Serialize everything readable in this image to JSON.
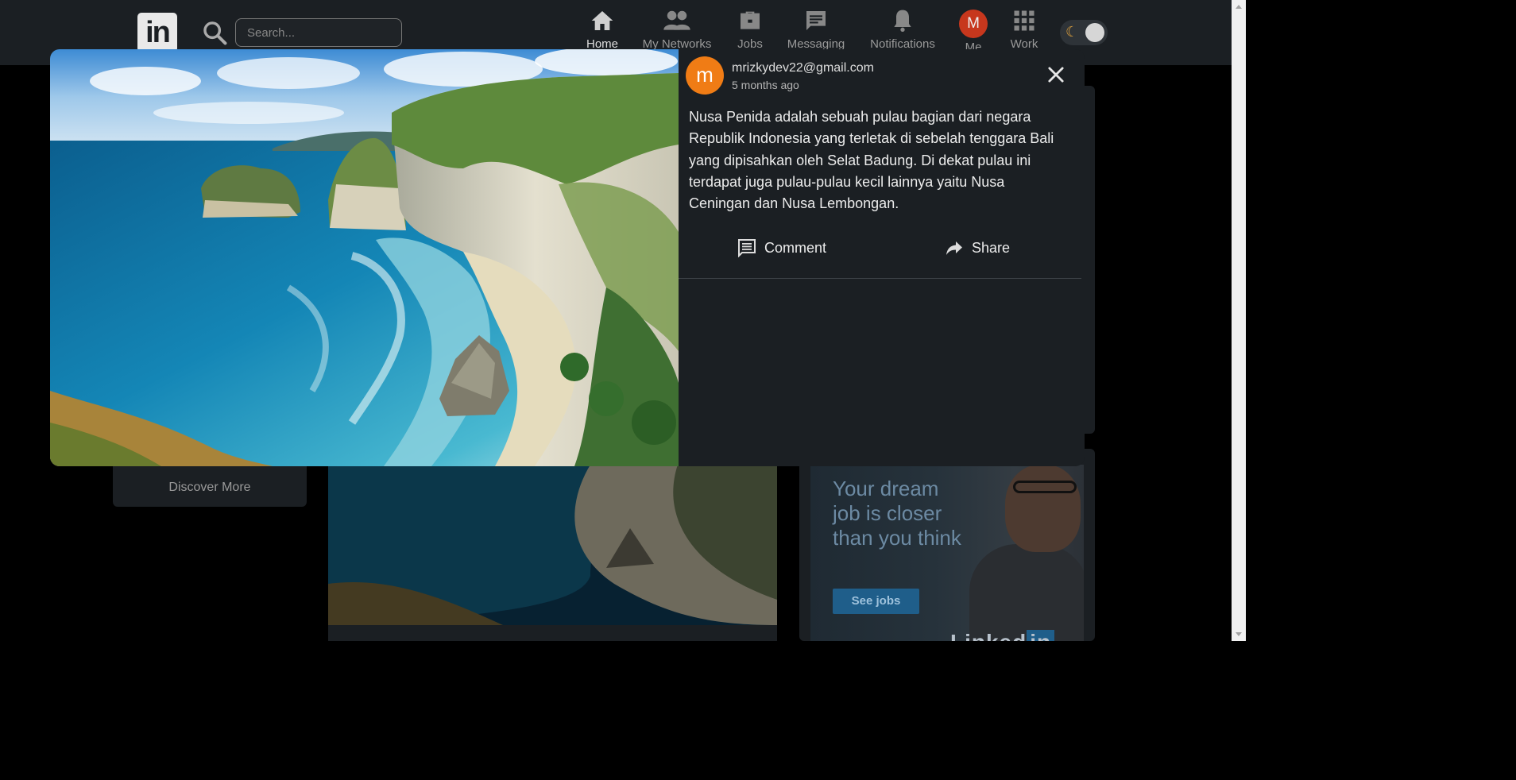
{
  "navbar": {
    "logo_text": "in",
    "search_placeholder": "Search...",
    "items": [
      {
        "label": "Home",
        "icon": "home-icon"
      },
      {
        "label": "My Networks",
        "icon": "people-icon"
      },
      {
        "label": "Jobs",
        "icon": "briefcase-icon"
      },
      {
        "label": "Messaging",
        "icon": "message-icon"
      },
      {
        "label": "Notifications",
        "icon": "bell-icon"
      },
      {
        "label": "Me",
        "avatar_letter": "M",
        "avatar_color": "#c7371d"
      },
      {
        "label": "Work",
        "icon": "grid-icon"
      }
    ],
    "theme_icon": "moon-icon"
  },
  "background": {
    "discover_label": "Discover More",
    "ad": {
      "headline": "Your dream job is closer than you think",
      "button_label": "See jobs"
    }
  },
  "modal": {
    "author": {
      "avatar_letter": "m",
      "avatar_color": "#f07c15",
      "name": "mrizkydev22@gmail.com",
      "time": "5 months ago"
    },
    "post_text": "Nusa Penida adalah sebuah pulau bagian dari negara Republik Indonesia yang terletak di sebelah tenggara Bali yang dipisahkan oleh Selat Badung. Di dekat pulau ini terdapat juga pulau-pulau kecil lainnya yaitu Nusa Ceningan dan Nusa Lembongan.",
    "actions": {
      "comment_label": "Comment",
      "share_label": "Share"
    }
  }
}
